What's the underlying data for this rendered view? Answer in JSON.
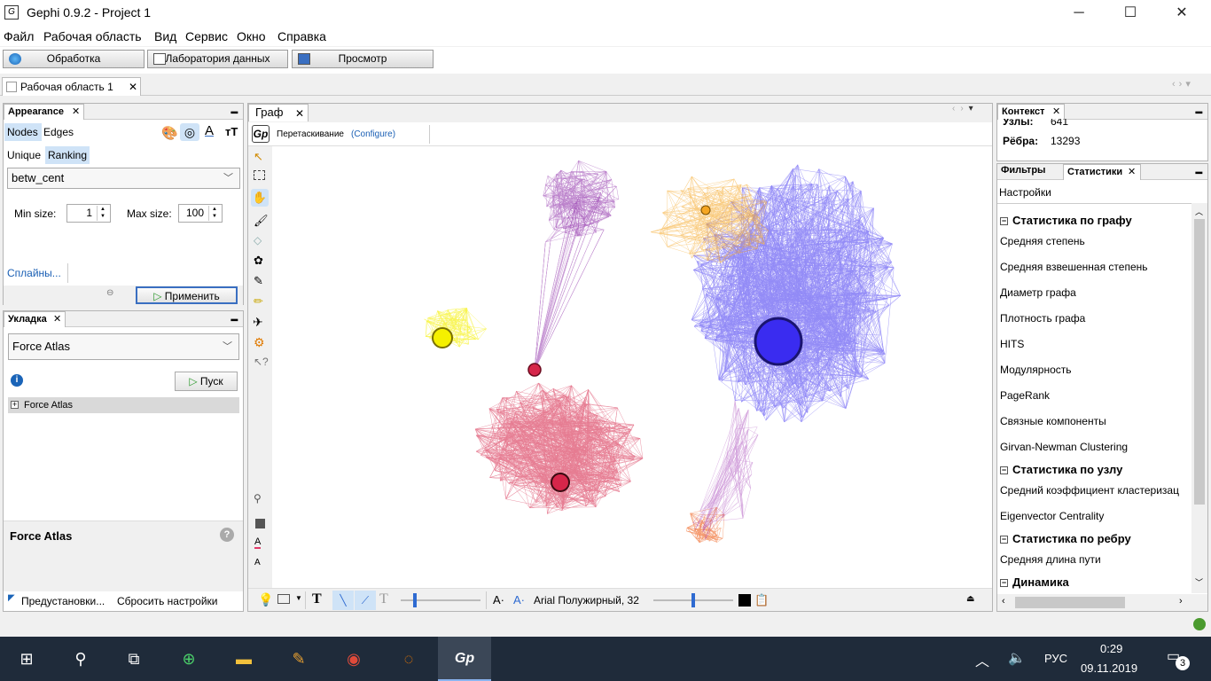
{
  "window": {
    "title": "Gephi 0.9.2 - Project 1",
    "minimize": "─",
    "maximize": "☐",
    "close": "✕"
  },
  "menu": [
    "Файл",
    "Рабочая область",
    "Вид",
    "Сервис",
    "Окно",
    "Справка"
  ],
  "modes": [
    "Обработка",
    "Лаборатория данных",
    "Просмотр"
  ],
  "workspace_tab": {
    "label": "Рабочая область 1",
    "close": "✕"
  },
  "appearance": {
    "title": "Appearance",
    "close": "✕",
    "tabs": [
      "Nodes",
      "Edges"
    ],
    "subtabs": [
      "Unique",
      "Ranking"
    ],
    "attribute": "betw_cent",
    "min_label": "Min size:",
    "min_value": "1",
    "max_label": "Max size:",
    "max_value": "100",
    "splines": "Сплайны...",
    "apply": "Применить",
    "text_icon": "A",
    "size_icon": "тT"
  },
  "layout": {
    "title": "Укладка",
    "close": "✕",
    "algorithm": "Force Atlas",
    "run": "Пуск",
    "tree_item": "Force Atlas",
    "desc_title": "Force Atlas",
    "presets": "Предустановки...",
    "reset": "Сбросить настройки"
  },
  "graph": {
    "tab": "Граф",
    "close": "✕",
    "drag_label": "Перетаскивание",
    "configure": "(Configure)",
    "font": "Arial Полужирный, 32"
  },
  "context": {
    "title": "Контекст",
    "close": "✕",
    "nodes_label": "Узлы:",
    "nodes_value": "641",
    "edges_label": "Рёбра:",
    "edges_value": "13293"
  },
  "stats": {
    "tabs": [
      "Фильтры",
      "Статистики"
    ],
    "close": "✕",
    "settings": "Настройки",
    "sections": [
      {
        "title": "Статистика по графу",
        "items": [
          "Средняя степень",
          "Средняя взвешенная степень",
          "Диаметр графа",
          "Плотность графа",
          "HITS",
          "Модулярность",
          "PageRank",
          "Связные компоненты",
          "Girvan-Newman Clustering"
        ]
      },
      {
        "title": "Статистика по узлу",
        "items": [
          "Средний коэффициент кластеризац",
          "Eigenvector Centrality"
        ]
      },
      {
        "title": "Статистика по ребру",
        "items": [
          "Средняя длина пути"
        ]
      },
      {
        "title": "Динамика",
        "items": []
      }
    ]
  },
  "taskbar": {
    "lang": "РУС",
    "time": "0:29",
    "date": "09.11.2019",
    "notifications": "3"
  },
  "colors": {
    "purple": "#8e2da8",
    "orange": "#f5a623",
    "blue": "#3a2cf0",
    "yellow": "#f5f000",
    "red": "#d6264a",
    "orange2": "#f06a2a"
  }
}
